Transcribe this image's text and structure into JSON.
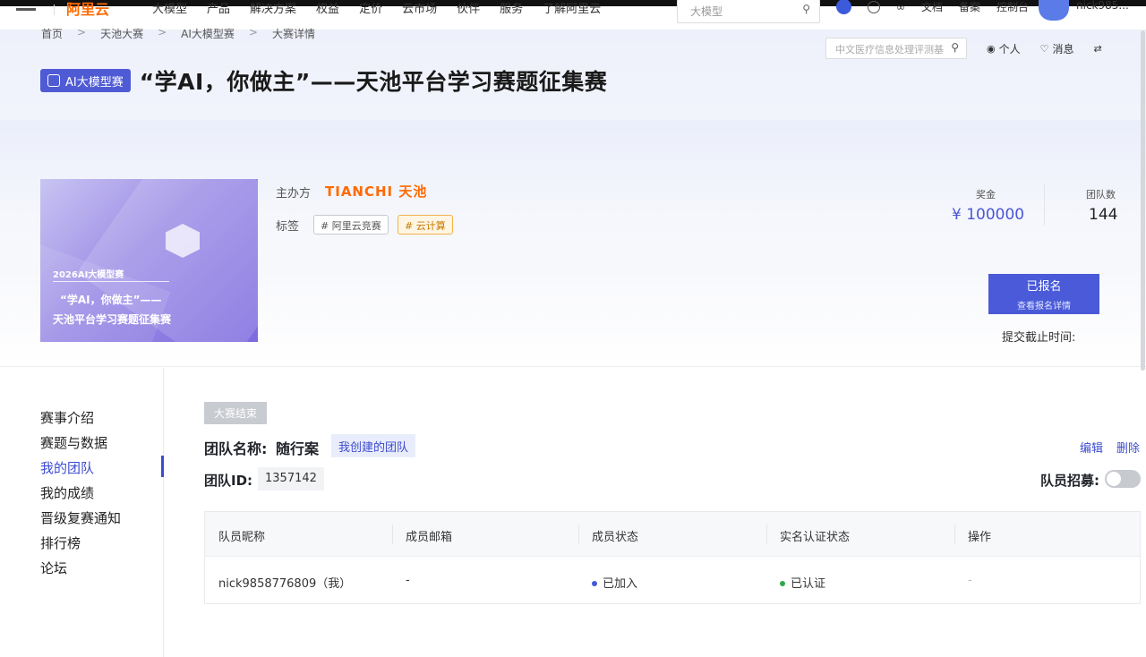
{
  "topbar": {
    "logo_text": "阿里云",
    "nav": [
      "大模型",
      "产品",
      "解决方案",
      "权益",
      "定价",
      "云市场",
      "伙伴",
      "服务",
      "了解阿里云"
    ],
    "search_placeholder": "大模型",
    "right_items": [
      "文档",
      "备案",
      "控制台"
    ],
    "user_name": "nick985..."
  },
  "breadcrumb": [
    "首页",
    "天池大赛",
    "AI大模型赛",
    "大赛详情"
  ],
  "hero_tools": {
    "search_placeholder": "中文医疗信息处理评测基",
    "personal": "个人",
    "messages": "消息"
  },
  "competition": {
    "badge": "AI大模型赛",
    "title": "“学AI，你做主”——天池平台学习赛题征集赛",
    "cover": {
      "line1": "2026AI大模型赛",
      "line2": "“学AI，你做主”——",
      "line3": "天池平台学习赛题征集赛"
    },
    "organizer_label": "主办方",
    "organizer_logo": "TIANCHI 天池",
    "tags_label": "标签",
    "tags": [
      "# 阿里云竞赛",
      "# 云计算"
    ],
    "prize_label": "奖金",
    "prize_value": "¥ 100000",
    "teams_label": "团队数",
    "teams_value": "144",
    "signup_button": "已报名",
    "signup_sub": "查看报名详情",
    "deadline_label": "提交截止时间:"
  },
  "sidebar": {
    "items": [
      "赛事介绍",
      "赛题与数据",
      "我的团队",
      "我的成绩",
      "晋级复赛通知",
      "排行榜",
      "论坛"
    ],
    "active_index": 2
  },
  "team": {
    "status": "大赛结束",
    "name_label": "团队名称:",
    "name_value": "随行案",
    "mine_chip": "我创建的团队",
    "edit": "编辑",
    "delete": "删除",
    "id_label": "团队ID:",
    "id_value": "1357142",
    "recruit_label": "队员招募:",
    "recruit_enabled": false
  },
  "members_table": {
    "headers": [
      "队员昵称",
      "成员邮箱",
      "成员状态",
      "实名认证状态",
      "操作"
    ],
    "rows": [
      {
        "nickname": "nick9858776809（我）",
        "email": "-",
        "status": "已加入",
        "status_color": "#3d5bd6",
        "verify": "已认证",
        "verify_color": "#2fa84f",
        "action": "-"
      }
    ]
  },
  "colors": {
    "accent": "#4a5ad8",
    "brand_orange": "#ff6a00"
  }
}
